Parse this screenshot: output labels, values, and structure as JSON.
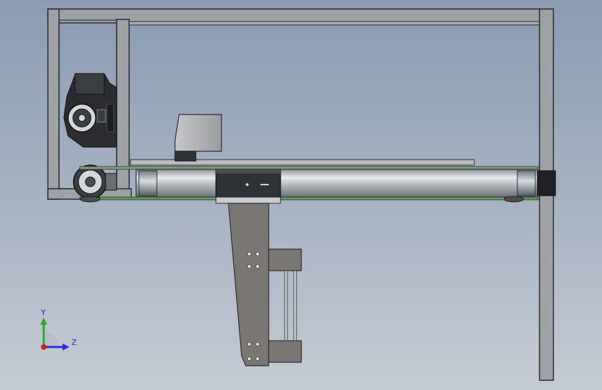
{
  "viewport": {
    "background_top": "#8a9bb3",
    "background_bottom": "#c5cbd4"
  },
  "triad": {
    "y_label": "Y",
    "z_label": "Z",
    "y_axis_color": "#22aa22",
    "z_axis_color": "#2233cc",
    "origin_color": "#cc2222"
  },
  "model": {
    "frame_color": "#9ea1a6",
    "frame_edge_color": "#2a2a2a",
    "roller_color": "#c9ccd1",
    "bracket_color": "#7a7674",
    "motor_color": "#2a2c30",
    "belt_edge_color": "#5aa05a"
  }
}
